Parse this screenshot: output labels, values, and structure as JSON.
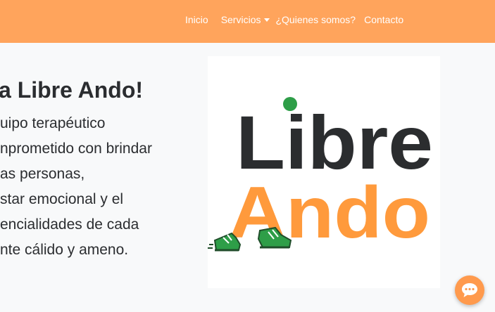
{
  "nav": {
    "items": [
      {
        "label": "Inicio"
      },
      {
        "label": "Servicios"
      },
      {
        "label": "¿Quienes somos?"
      },
      {
        "label": "Contacto"
      }
    ]
  },
  "hero": {
    "title": "a Libre Ando!",
    "lines": [
      "uipo terapéutico",
      "nprometido con brindar",
      "as personas,",
      "star emocional y el",
      "encialidades de cada",
      "nte cálido y ameno."
    ]
  },
  "logo": {
    "word1": "Libre",
    "word2": "Ando",
    "colors": {
      "dark": "#2b2d2f",
      "orange": "#ff9a3c",
      "green": "#2e9e48"
    }
  },
  "icons": {
    "dropdown": "caret-down-icon",
    "chat": "chat-bubble-icon"
  },
  "colors": {
    "navbar": "#ffa45c",
    "page_background": "#f8f9fa",
    "text": "#2b2d30",
    "chat_button": "#ff9a4d"
  }
}
